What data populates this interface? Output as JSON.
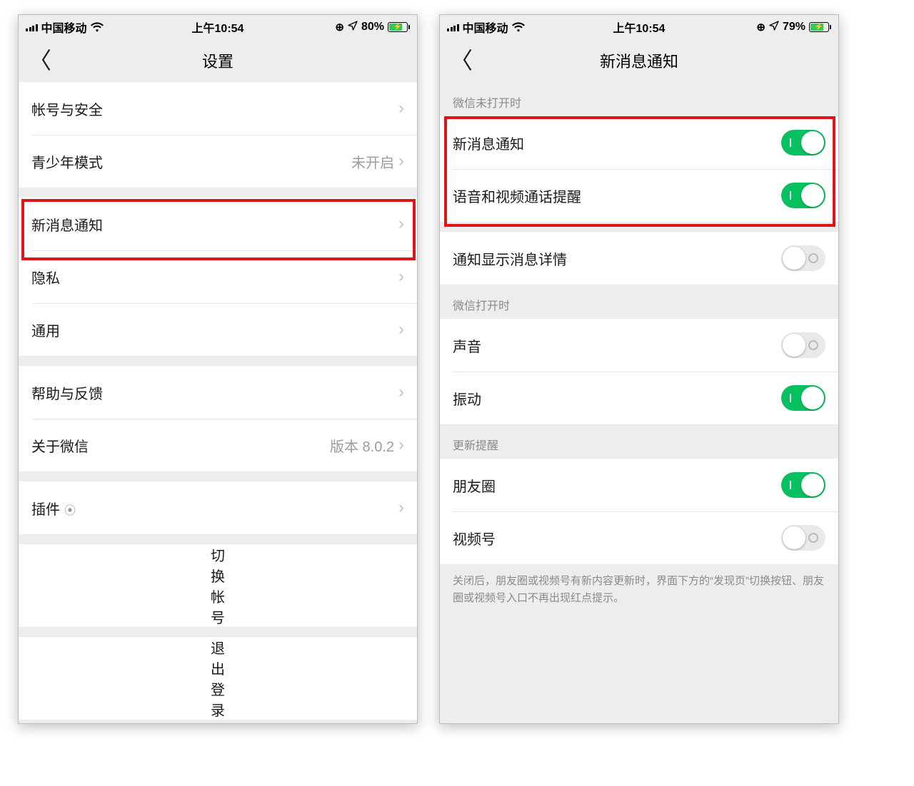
{
  "left": {
    "status": {
      "carrier": "中国移动",
      "time": "上午10:54",
      "battery": "80%"
    },
    "nav": {
      "title": "设置"
    },
    "account_security": "帐号与安全",
    "youth_mode": {
      "label": "青少年模式",
      "value": "未开启"
    },
    "new_msg_notify": "新消息通知",
    "privacy": "隐私",
    "general": "通用",
    "help_feedback": "帮助与反馈",
    "about": {
      "label": "关于微信",
      "value": "版本 8.0.2"
    },
    "plugins": "插件",
    "switch_account": "切换帐号",
    "logout": "退出登录"
  },
  "right": {
    "status": {
      "carrier": "中国移动",
      "time": "上午10:54",
      "battery": "79%"
    },
    "nav": {
      "title": "新消息通知"
    },
    "section1_title": "微信未打开时",
    "new_msg": {
      "label": "新消息通知",
      "on": true
    },
    "voice_video": {
      "label": "语音和视频通话提醒",
      "on": true
    },
    "show_detail": {
      "label": "通知显示消息详情",
      "on": false
    },
    "section2_title": "微信打开时",
    "sound": {
      "label": "声音",
      "on": false
    },
    "vibrate": {
      "label": "振动",
      "on": true
    },
    "section3_title": "更新提醒",
    "moments": {
      "label": "朋友圈",
      "on": true
    },
    "channels": {
      "label": "视频号",
      "on": false
    },
    "footer": "关闭后，朋友圈或视频号有新内容更新时，界面下方的“发现页”切换按钮、朋友圈或视频号入口不再出现红点提示。"
  }
}
